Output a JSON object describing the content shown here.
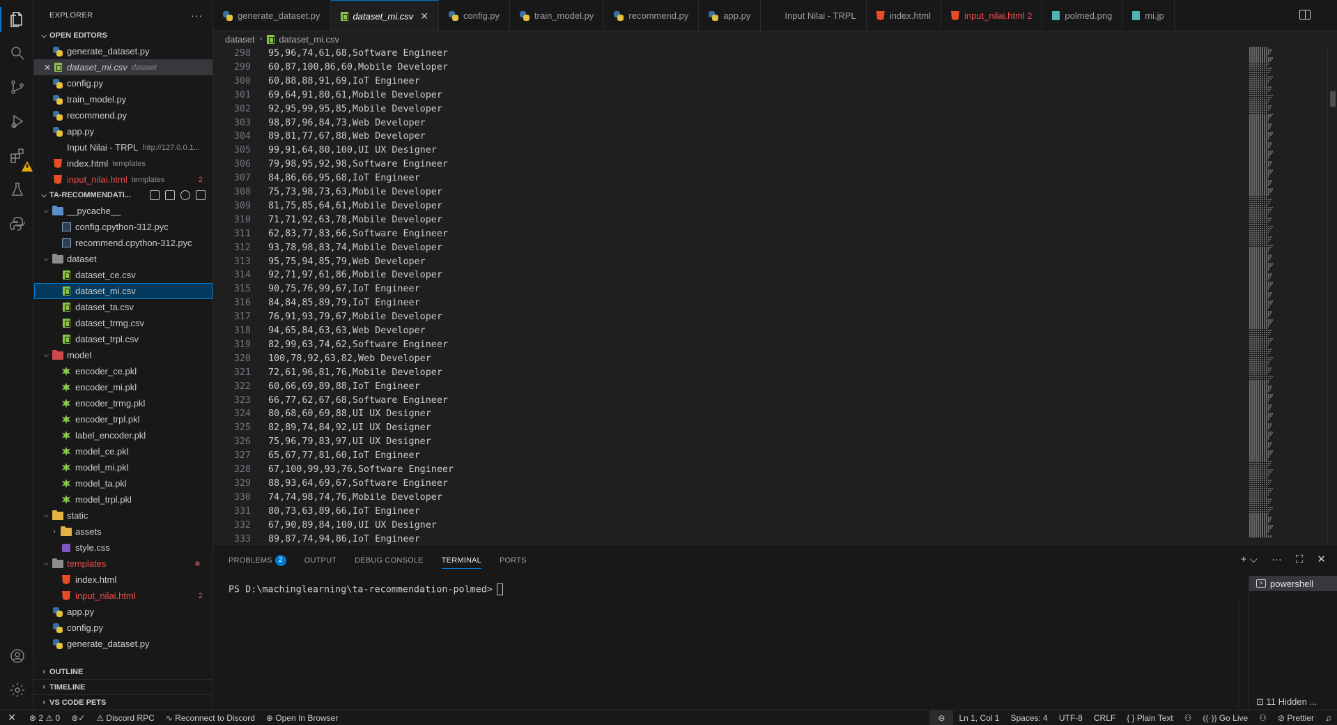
{
  "sidebar": {
    "title": "EXPLORER",
    "open_editors_title": "OPEN EDITORS",
    "open_editors": [
      {
        "label": "generate_dataset.py",
        "icon": "python-icon",
        "desc": "",
        "count": ""
      },
      {
        "label": "dataset_mi.csv",
        "icon": "csv-icon",
        "desc": "dataset",
        "count": ""
      },
      {
        "label": "config.py",
        "icon": "python-icon",
        "desc": "",
        "count": ""
      },
      {
        "label": "train_model.py",
        "icon": "python-icon",
        "desc": "",
        "count": ""
      },
      {
        "label": "recommend.py",
        "icon": "python-icon",
        "desc": "",
        "count": ""
      },
      {
        "label": "app.py",
        "icon": "python-icon",
        "desc": "",
        "count": ""
      },
      {
        "label": "Input Nilai - TRPL",
        "icon": "",
        "desc": "http://127.0.0.1...",
        "count": ""
      },
      {
        "label": "index.html",
        "icon": "html-icon",
        "desc": "templates",
        "count": ""
      },
      {
        "label": "input_nilai.html",
        "icon": "html-icon",
        "desc": "templates",
        "count": "2"
      }
    ],
    "project_title": "TA-RECOMMENDATI...",
    "tree": [
      {
        "label": "__pycache__",
        "type": "folder",
        "color": "blue",
        "depth": 1,
        "open": true
      },
      {
        "label": "config.cpython-312.pyc",
        "type": "pyc",
        "depth": 2
      },
      {
        "label": "recommend.cpython-312.pyc",
        "type": "pyc",
        "depth": 2
      },
      {
        "label": "dataset",
        "type": "folder",
        "color": "gray",
        "depth": 1,
        "open": true
      },
      {
        "label": "dataset_ce.csv",
        "type": "csv",
        "depth": 2
      },
      {
        "label": "dataset_mi.csv",
        "type": "csv",
        "depth": 2,
        "selected": true
      },
      {
        "label": "dataset_ta.csv",
        "type": "csv",
        "depth": 2
      },
      {
        "label": "dataset_trmg.csv",
        "type": "csv",
        "depth": 2
      },
      {
        "label": "dataset_trpl.csv",
        "type": "csv",
        "depth": 2
      },
      {
        "label": "model",
        "type": "folder",
        "color": "red",
        "depth": 1,
        "open": true
      },
      {
        "label": "encoder_ce.pkl",
        "type": "pkl",
        "depth": 2
      },
      {
        "label": "encoder_mi.pkl",
        "type": "pkl",
        "depth": 2
      },
      {
        "label": "encoder_trmg.pkl",
        "type": "pkl",
        "depth": 2
      },
      {
        "label": "encoder_trpl.pkl",
        "type": "pkl",
        "depth": 2
      },
      {
        "label": "label_encoder.pkl",
        "type": "pkl",
        "depth": 2
      },
      {
        "label": "model_ce.pkl",
        "type": "pkl",
        "depth": 2
      },
      {
        "label": "model_mi.pkl",
        "type": "pkl",
        "depth": 2
      },
      {
        "label": "model_ta.pkl",
        "type": "pkl",
        "depth": 2
      },
      {
        "label": "model_trpl.pkl",
        "type": "pkl",
        "depth": 2
      },
      {
        "label": "static",
        "type": "folder",
        "color": "yellow",
        "depth": 1,
        "open": true
      },
      {
        "label": "assets",
        "type": "folder",
        "color": "yellow",
        "depth": 2,
        "open": false
      },
      {
        "label": "style.css",
        "type": "css",
        "depth": 2
      },
      {
        "label": "templates",
        "type": "folder",
        "color": "gray",
        "depth": 1,
        "open": true,
        "modified": true,
        "error": true
      },
      {
        "label": "index.html",
        "type": "html",
        "depth": 2
      },
      {
        "label": "input_nilai.html",
        "type": "html",
        "depth": 2,
        "error": true,
        "count": "2"
      },
      {
        "label": "app.py",
        "type": "py",
        "depth": 1
      },
      {
        "label": "config.py",
        "type": "py",
        "depth": 1
      },
      {
        "label": "generate_dataset.py",
        "type": "py",
        "depth": 1
      }
    ],
    "outline_title": "OUTLINE",
    "timeline_title": "TIMELINE",
    "pets_title": "VS CODE PETS"
  },
  "tabs": [
    {
      "label": "generate_dataset.py",
      "icon": "python-icon"
    },
    {
      "label": "dataset_mi.csv",
      "icon": "csv-icon",
      "active": true
    },
    {
      "label": "config.py",
      "icon": "python-icon"
    },
    {
      "label": "train_model.py",
      "icon": "python-icon"
    },
    {
      "label": "recommend.py",
      "icon": "python-icon"
    },
    {
      "label": "app.py",
      "icon": "python-icon"
    },
    {
      "label": "Input Nilai - TRPL",
      "icon": ""
    },
    {
      "label": "index.html",
      "icon": "html-icon"
    },
    {
      "label": "input_nilai.html",
      "icon": "html-icon",
      "error": true,
      "count": "2"
    },
    {
      "label": "polmed.png",
      "icon": "image-icon"
    },
    {
      "label": "mi.jp",
      "icon": "image-icon"
    }
  ],
  "breadcrumb": {
    "folder": "dataset",
    "file": "dataset_mi.csv"
  },
  "editor": {
    "lines": [
      {
        "n": "298",
        "t": "95,96,74,61,68,Software Engineer"
      },
      {
        "n": "299",
        "t": "60,87,100,86,60,Mobile Developer"
      },
      {
        "n": "300",
        "t": "60,88,88,91,69,IoT Engineer"
      },
      {
        "n": "301",
        "t": "69,64,91,80,61,Mobile Developer"
      },
      {
        "n": "302",
        "t": "92,95,99,95,85,Mobile Developer"
      },
      {
        "n": "303",
        "t": "98,87,96,84,73,Web Developer"
      },
      {
        "n": "304",
        "t": "89,81,77,67,88,Web Developer"
      },
      {
        "n": "305",
        "t": "99,91,64,80,100,UI UX Designer"
      },
      {
        "n": "306",
        "t": "79,98,95,92,98,Software Engineer"
      },
      {
        "n": "307",
        "t": "84,86,66,95,68,IoT Engineer"
      },
      {
        "n": "308",
        "t": "75,73,98,73,63,Mobile Developer"
      },
      {
        "n": "309",
        "t": "81,75,85,64,61,Mobile Developer"
      },
      {
        "n": "310",
        "t": "71,71,92,63,78,Mobile Developer"
      },
      {
        "n": "311",
        "t": "62,83,77,83,66,Software Engineer"
      },
      {
        "n": "312",
        "t": "93,78,98,83,74,Mobile Developer"
      },
      {
        "n": "313",
        "t": "95,75,94,85,79,Web Developer"
      },
      {
        "n": "314",
        "t": "92,71,97,61,86,Mobile Developer"
      },
      {
        "n": "315",
        "t": "90,75,76,99,67,IoT Engineer"
      },
      {
        "n": "316",
        "t": "84,84,85,89,79,IoT Engineer"
      },
      {
        "n": "317",
        "t": "76,91,93,79,67,Mobile Developer"
      },
      {
        "n": "318",
        "t": "94,65,84,63,63,Web Developer"
      },
      {
        "n": "319",
        "t": "82,99,63,74,62,Software Engineer"
      },
      {
        "n": "320",
        "t": "100,78,92,63,82,Web Developer"
      },
      {
        "n": "321",
        "t": "72,61,96,81,76,Mobile Developer"
      },
      {
        "n": "322",
        "t": "60,66,69,89,88,IoT Engineer"
      },
      {
        "n": "323",
        "t": "66,77,62,67,68,Software Engineer"
      },
      {
        "n": "324",
        "t": "80,68,60,69,88,UI UX Designer"
      },
      {
        "n": "325",
        "t": "82,89,74,84,92,UI UX Designer"
      },
      {
        "n": "326",
        "t": "75,96,79,83,97,UI UX Designer"
      },
      {
        "n": "327",
        "t": "65,67,77,81,60,IoT Engineer"
      },
      {
        "n": "328",
        "t": "67,100,99,93,76,Software Engineer"
      },
      {
        "n": "329",
        "t": "88,93,64,69,67,Software Engineer"
      },
      {
        "n": "330",
        "t": "74,74,98,74,76,Mobile Developer"
      },
      {
        "n": "331",
        "t": "80,73,63,89,66,IoT Engineer"
      },
      {
        "n": "332",
        "t": "67,90,89,84,100,UI UX Designer"
      },
      {
        "n": "333",
        "t": "89,87,74,94,86,IoT Engineer"
      }
    ]
  },
  "panel": {
    "tabs": [
      "PROBLEMS",
      "OUTPUT",
      "DEBUG CONSOLE",
      "TERMINAL",
      "PORTS"
    ],
    "problems_count": "2",
    "active_tab": "TERMINAL",
    "prompt": "PS D:\\machinglearning\\ta-recommendation-polmed>",
    "terminal_name": "powershell",
    "hidden_terminals": "11 Hidden ..."
  },
  "status": {
    "errors": "2",
    "warnings": "0",
    "discord": "Discord RPC",
    "reconnect": "Reconnect to Discord",
    "open_browser": "Open In Browser",
    "position": "Ln 1, Col 1",
    "spaces": "Spaces: 4",
    "encoding": "UTF-8",
    "eol": "CRLF",
    "language": "Plain Text",
    "golive": "Go Live",
    "prettier": "Prettier"
  },
  "colors": {
    "accent": "#0078d4",
    "error": "#f14c4c",
    "background": "#1f1f1f",
    "sidebar": "#181818"
  }
}
